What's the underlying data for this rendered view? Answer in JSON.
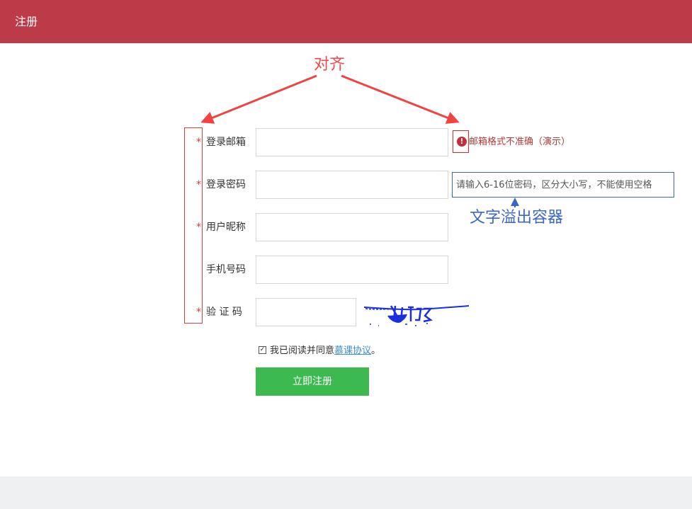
{
  "header": {
    "title": "注册"
  },
  "annotations": {
    "align": "对齐",
    "overflow": "文字溢出容器"
  },
  "form": {
    "fields": [
      {
        "required_mark": "*",
        "label": "登录邮箱",
        "value": ""
      },
      {
        "required_mark": "*",
        "label": "登录密码",
        "value": ""
      },
      {
        "required_mark": "*",
        "label": "用户昵称",
        "value": ""
      },
      {
        "required_mark": "",
        "label": "手机号码",
        "value": ""
      },
      {
        "required_mark": "*",
        "label": "验 证 码",
        "value": ""
      }
    ],
    "email_error": {
      "icon": "!",
      "text": "邮箱格式不准确（演示）"
    },
    "password_tip": "请输入6-16位密码，区分大小写，不能使用空格",
    "agree": {
      "checked": true,
      "prefix": "我已阅读并同意",
      "link": "慕课协议",
      "suffix": "。"
    },
    "submit_label": "立即注册"
  },
  "colors": {
    "header_bg": "#bd3a48",
    "submit_bg": "#3cba50",
    "error": "#c62f3a",
    "tip_border": "#3b64c3",
    "annotation_red": "#ee4a4a",
    "annotation_blue": "#3e66c8"
  }
}
